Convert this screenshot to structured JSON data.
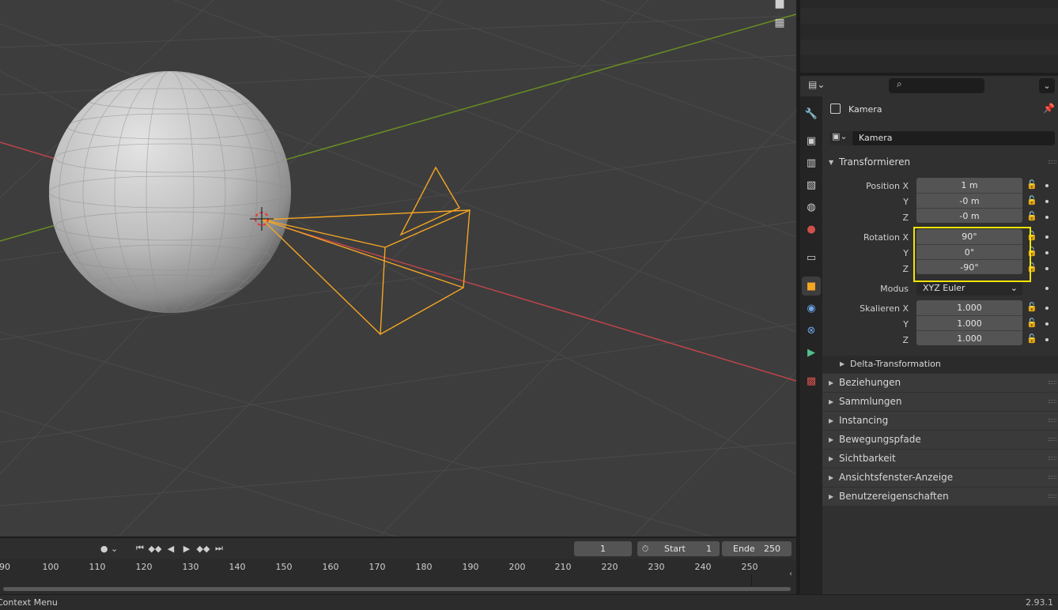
{
  "viewport": {
    "icons": {
      "camera_view": "camera-icon",
      "grid": "grid-toggle-icon"
    }
  },
  "timeline": {
    "current_frame": "1",
    "start_label": "Start",
    "start_value": "1",
    "end_label": "Ende",
    "end_value": "250",
    "ticks": [
      "90",
      "100",
      "110",
      "120",
      "130",
      "140",
      "150",
      "160",
      "170",
      "180",
      "190",
      "200",
      "210",
      "220",
      "230",
      "240",
      "250"
    ]
  },
  "status": {
    "left": "Context Menu",
    "version": "2.93.1"
  },
  "properties": {
    "search_placeholder": "",
    "object_name": "Kamera",
    "object_field_value": "Kamera",
    "transform_panel": "Transformieren",
    "position": {
      "label": "Position X",
      "y_label": "Y",
      "z_label": "Z",
      "x": "1 m",
      "y": "-0 m",
      "z": "-0 m"
    },
    "rotation": {
      "label": "Rotation X",
      "y_label": "Y",
      "z_label": "Z",
      "x": "90°",
      "y": "0°",
      "z": "-90°"
    },
    "mode": {
      "label": "Modus",
      "value": "XYZ Euler"
    },
    "scale": {
      "label": "Skalieren X",
      "y_label": "Y",
      "z_label": "Z",
      "x": "1.000",
      "y": "1.000",
      "z": "1.000"
    },
    "delta_panel": "Delta-Transformation",
    "panels": [
      "Beziehungen",
      "Sammlungen",
      "Instancing",
      "Bewegungspfade",
      "Sichtbarkeit",
      "Ansichtsfenster-Anzeige",
      "Benutzereigenschaften"
    ]
  },
  "colors": {
    "highlight": "#f2e500",
    "camera_wire": "#f5a623",
    "x_axis": "#c0454a",
    "y_axis": "#6a8e23"
  }
}
